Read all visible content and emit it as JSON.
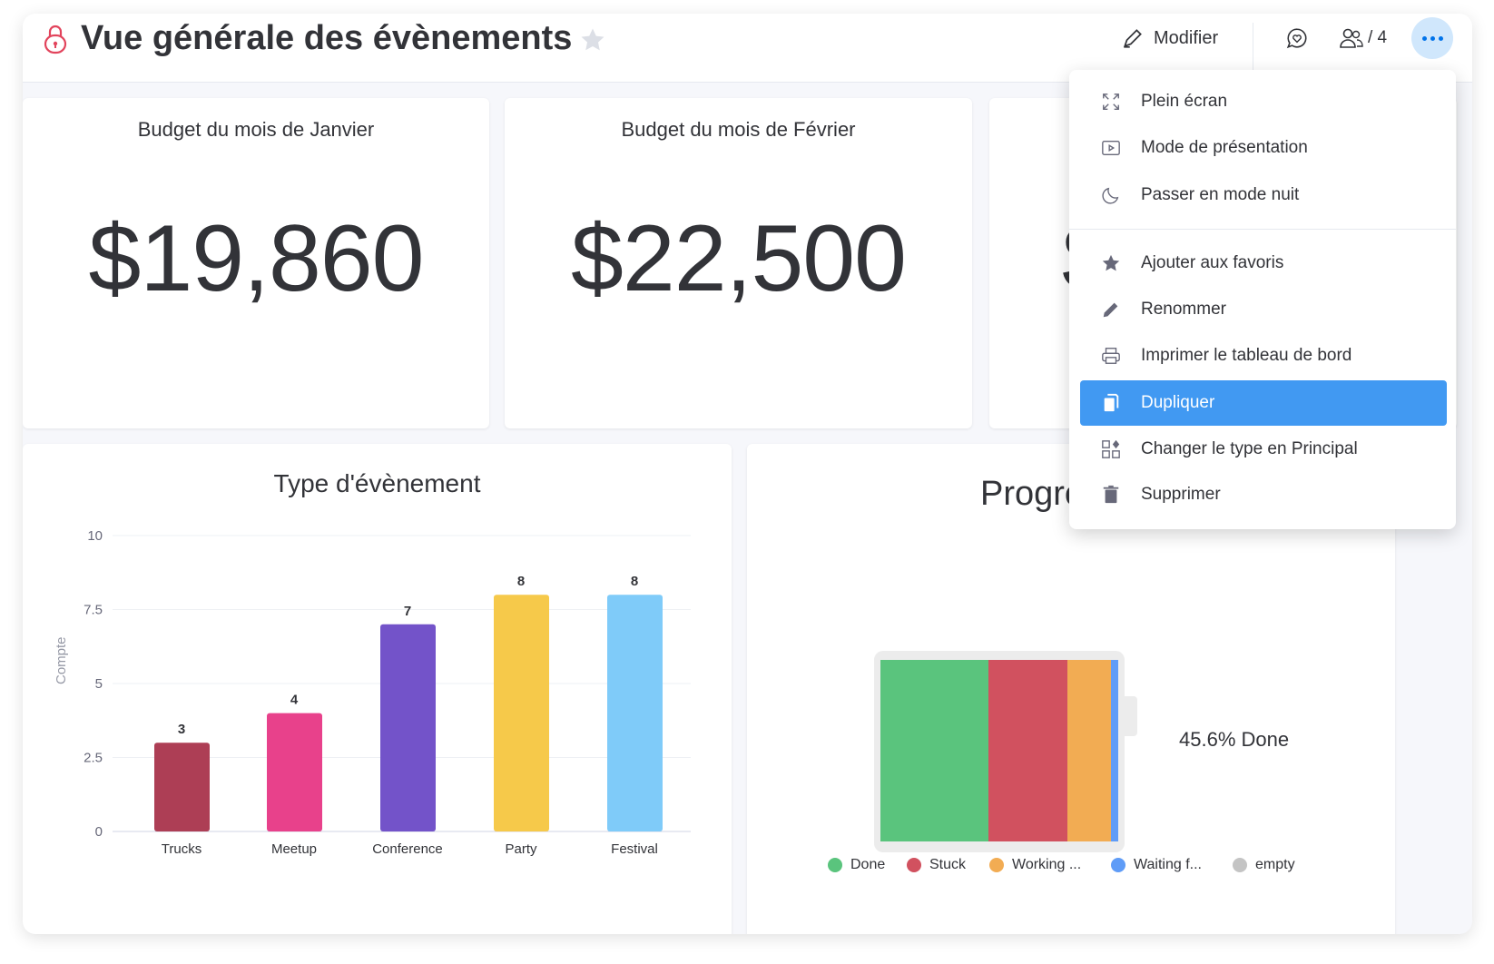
{
  "header": {
    "title": "Vue générale des évènements",
    "edit_label": "Modifier",
    "members": "/ 4"
  },
  "budgets": [
    {
      "title": "Budget du mois de Janvier",
      "value": "$19,860"
    },
    {
      "title": "Budget du mois de Février",
      "value": "$22,500"
    },
    {
      "value_visible": "$"
    }
  ],
  "menu": {
    "items": [
      {
        "label": "Plein écran",
        "icon": "fullscreen-icon"
      },
      {
        "label": "Mode de présentation",
        "icon": "presentation-icon"
      },
      {
        "label": "Passer en mode nuit",
        "icon": "moon-icon"
      },
      {
        "label": "Ajouter aux favoris",
        "icon": "star-icon"
      },
      {
        "label": "Renommer",
        "icon": "pencil-icon"
      },
      {
        "label": "Imprimer le tableau de bord",
        "icon": "printer-icon"
      },
      {
        "label": "Dupliquer",
        "icon": "duplicate-icon",
        "highlighted": true
      },
      {
        "label": "Changer le type en Principal",
        "icon": "widgets-icon"
      },
      {
        "label": "Supprimer",
        "icon": "trash-icon"
      }
    ]
  },
  "chart_data": [
    {
      "type": "bar",
      "title": "Type d'évènement",
      "ylabel": "Compte",
      "xlabel": "",
      "categories": [
        "Trucks",
        "Meetup",
        "Conference",
        "Party",
        "Festival"
      ],
      "values": [
        3,
        4,
        7,
        8,
        8
      ],
      "colors": [
        "#ad3e55",
        "#e8418b",
        "#7353c9",
        "#f6c94a",
        "#7fcbf9"
      ],
      "yticks": [
        "0",
        "2.5",
        "5",
        "7.5",
        "10"
      ],
      "ylim": [
        0,
        10
      ],
      "grid": true
    },
    {
      "type": "bar",
      "orientation": "stacked-horizontal",
      "title": "Progre",
      "summary": "45.6% Done",
      "series": [
        {
          "name": "Done",
          "value": 45.6,
          "color": "#5ac47d"
        },
        {
          "name": "Stuck",
          "value": 33.2,
          "color": "#d1515f"
        },
        {
          "name": "Working ...",
          "value": 18.2,
          "color": "#f2ac53"
        },
        {
          "name": "Waiting f...",
          "value": 3.0,
          "color": "#5f9cf7"
        },
        {
          "name": "empty",
          "value": 0,
          "color": "#c4c4c4"
        }
      ],
      "legend": "bottom"
    }
  ]
}
